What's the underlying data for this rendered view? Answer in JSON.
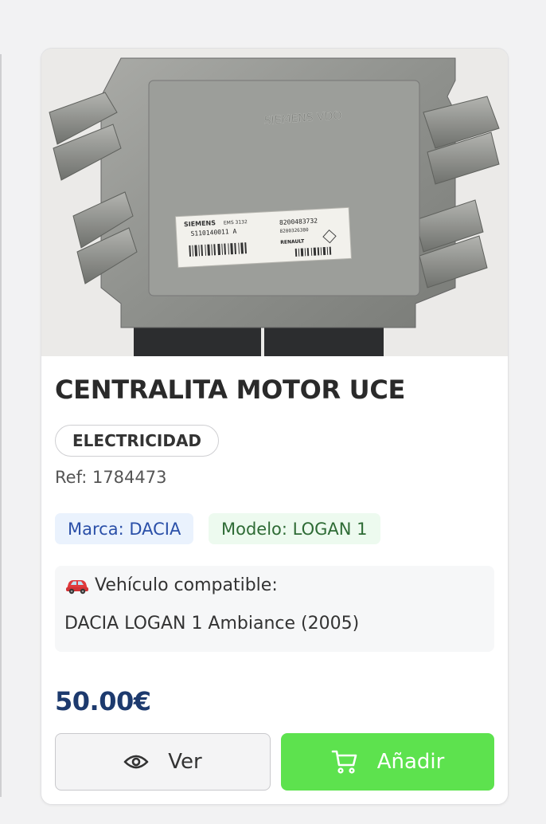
{
  "product": {
    "title": "CENTRALITA MOTOR UCE",
    "category": "ELECTRICIDAD",
    "ref": "Ref: 1784473",
    "brand_tag": "Marca: DACIA",
    "model_tag": "Modelo: LOGAN 1",
    "compatible_heading": "Vehículo compatible:",
    "compatible_vehicle": "DACIA LOGAN 1 Ambiance (2005)",
    "price": "50.00€",
    "image_label": {
      "maker": "SIEMENS",
      "ems": "EMS 3132",
      "serial": "S110140011 A",
      "part_number": "8200483732",
      "part_number_2": "8200326380",
      "brand": "RENAULT",
      "cast_logo": "SIEMENS VDO"
    }
  },
  "actions": {
    "view_label": "Ver",
    "add_label": "Añadir"
  },
  "icons": {
    "car": "car-icon",
    "view": "eye-icon",
    "add": "cart-icon"
  },
  "colors": {
    "price": "#1d3a6e",
    "add_button": "#5de24e",
    "brand_tag_bg": "#eaf2fd",
    "brand_tag_text": "#2a4fa8",
    "model_tag_bg": "#edfaef",
    "model_tag_text": "#2e6b35"
  }
}
